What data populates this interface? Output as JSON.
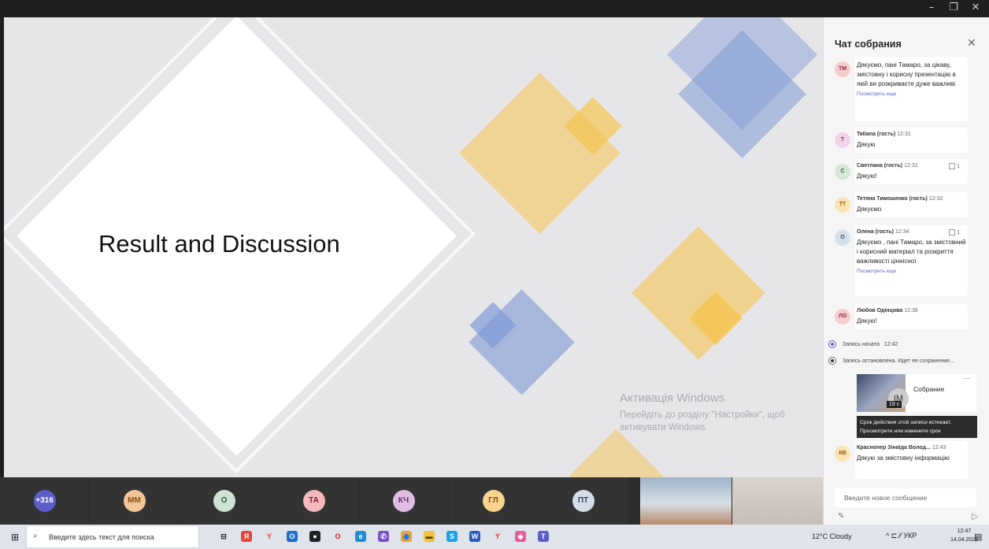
{
  "window": {
    "minimize_icon": "minimize-icon",
    "maximize_icon": "restore-icon",
    "close_icon": "close-icon"
  },
  "slide": {
    "title": "Result and Discussion",
    "colors": {
      "background": "#e6e6e9",
      "yellow": "#f5c451",
      "blue": "#7f9ad6"
    }
  },
  "watermark": {
    "line1": "Активація Windows",
    "line2": "Перейдіть до розділу \"Настройки\", щоб активувати Windows."
  },
  "participants": {
    "tiles": [
      {
        "label": "+316",
        "color": "#5b5fc7",
        "text_color": "#ffffff"
      },
      {
        "label": "ММ",
        "color": "#f3c69a",
        "text_color": "#8a4b12"
      },
      {
        "label": "О",
        "color": "#cfe3d5",
        "text_color": "#2b5a38"
      },
      {
        "label": "ТА",
        "color": "#f5b8bd",
        "text_color": "#8a1c25"
      },
      {
        "label": "КЧ",
        "color": "#e0bde3",
        "text_color": "#6a2a73"
      },
      {
        "label": "ГЛ",
        "color": "#f8d48f",
        "text_color": "#7a4a05"
      },
      {
        "label": "ПТ",
        "color": "#d5dde8",
        "text_color": "#33475f"
      }
    ]
  },
  "chat": {
    "title": "Чат собрания",
    "close_icon": "close-icon",
    "messages": [
      {
        "initials": "ТМ",
        "avatar_color": "#f5cdd0",
        "initials_color": "#9b2a35",
        "author": "",
        "time": "",
        "text": "Дякуємо, пані Тамаро, за цікаву, змістовну і корисну презентацію в якій ви розкриваєте дуже важливі",
        "more": "Посмотреть еще",
        "reaction": ""
      },
      {
        "initials": "Т",
        "avatar_color": "#f2d4e9",
        "initials_color": "#8a2b6e",
        "author": "Tatiana (гость)",
        "time": "12:31",
        "text": "Дякую",
        "more": "",
        "reaction": ""
      },
      {
        "initials": "С",
        "avatar_color": "#d6e6d7",
        "initials_color": "#2f6234",
        "author": "Светлана (гость)",
        "time": "12:32",
        "text": "Дякую!",
        "more": "",
        "reaction": "1"
      },
      {
        "initials": "ТТ",
        "avatar_color": "#fbe3b3",
        "initials_color": "#8a5a05",
        "author": "Тетяна Тимошенко (гость)",
        "time": "12:32",
        "text": "Дякуємо",
        "more": "",
        "reaction": ""
      },
      {
        "initials": "О",
        "avatar_color": "#d6e1ec",
        "initials_color": "#2c4d70",
        "author": "Олена (гость)",
        "time": "12:34",
        "text": "Дякуємо , пані Тамаро, за змістовний і корисний матеріал та розкриття важливості ціннісної",
        "more": "Посмотреть еще",
        "reaction": "1"
      },
      {
        "initials": "ЛО",
        "avatar_color": "#f5cdd0",
        "initials_color": "#9b2a35",
        "author": "Любов Одінцова",
        "time": "12:38",
        "text": "Дякую!",
        "more": "",
        "reaction": ""
      },
      {
        "initials": "КВ",
        "avatar_color": "#fbe3b3",
        "initials_color": "#8a5a05",
        "author": "Краснопер Зінаїда Волод...",
        "time": "12:43",
        "text": "Дякую за змістовну інформацію",
        "more": "",
        "reaction": ""
      }
    ],
    "system": [
      {
        "text": "Запись начата",
        "time": "12:42"
      },
      {
        "text": "Запись остановлена. Идет ее сохранение...",
        "time": ""
      }
    ],
    "recording": {
      "initials": "IM",
      "duration": "19 с",
      "name": "Собрание",
      "more_icon": "more-options-icon",
      "expire_line1": "Срок действия этой записи истекает.",
      "expire_line2": "Просмотрите или измените срок"
    },
    "compose_placeholder": "Введите новое сообщение",
    "format_icon": "format-icon",
    "send_icon": "send-icon"
  },
  "taskbar": {
    "search_placeholder": "Введите здесь текст для поиска",
    "weather": "12°C  Cloudy",
    "tray": "^  ⊏  ⁄⁄  УКР",
    "time": "12:47",
    "date": "14.04.2022",
    "apps": [
      {
        "icon": "task-view-icon",
        "glyph": "⊟",
        "color": "#dfe3ea",
        "fg": "#222"
      },
      {
        "icon": "yandex-icon",
        "glyph": "Я",
        "color": "#e8443a",
        "fg": "#fff"
      },
      {
        "icon": "yandex-browser-icon",
        "glyph": "Y",
        "color": "#dfe3ea",
        "fg": "#e8443a"
      },
      {
        "icon": "outlook-icon",
        "glyph": "O",
        "color": "#1d6fd1",
        "fg": "#fff"
      },
      {
        "icon": "obs-icon",
        "glyph": "●",
        "color": "#222",
        "fg": "#fff"
      },
      {
        "icon": "opera-icon",
        "glyph": "O",
        "color": "#dfe3ea",
        "fg": "#e11d1d"
      },
      {
        "icon": "edge-icon",
        "glyph": "e",
        "color": "#1f8fd6",
        "fg": "#fff"
      },
      {
        "icon": "viber-icon",
        "glyph": "✆",
        "color": "#7d52c7",
        "fg": "#fff"
      },
      {
        "icon": "chrome-icon",
        "glyph": "◉",
        "color": "#e8a33a",
        "fg": "#1a73e8"
      },
      {
        "icon": "file-explorer-icon",
        "glyph": "▬",
        "color": "#f2c23c",
        "fg": "#5a4300"
      },
      {
        "icon": "skype-icon",
        "glyph": "S",
        "color": "#1aa3e8",
        "fg": "#fff"
      },
      {
        "icon": "word-icon",
        "glyph": "W",
        "color": "#2b5bb9",
        "fg": "#fff"
      },
      {
        "icon": "yandex-market-icon",
        "glyph": "Y",
        "color": "#dfe3ea",
        "fg": "#e23b3b"
      },
      {
        "icon": "paint-icon",
        "glyph": "◈",
        "color": "#ea5a9c",
        "fg": "#fff"
      },
      {
        "icon": "teams-icon",
        "glyph": "T",
        "color": "#5b5fc7",
        "fg": "#fff"
      }
    ]
  }
}
